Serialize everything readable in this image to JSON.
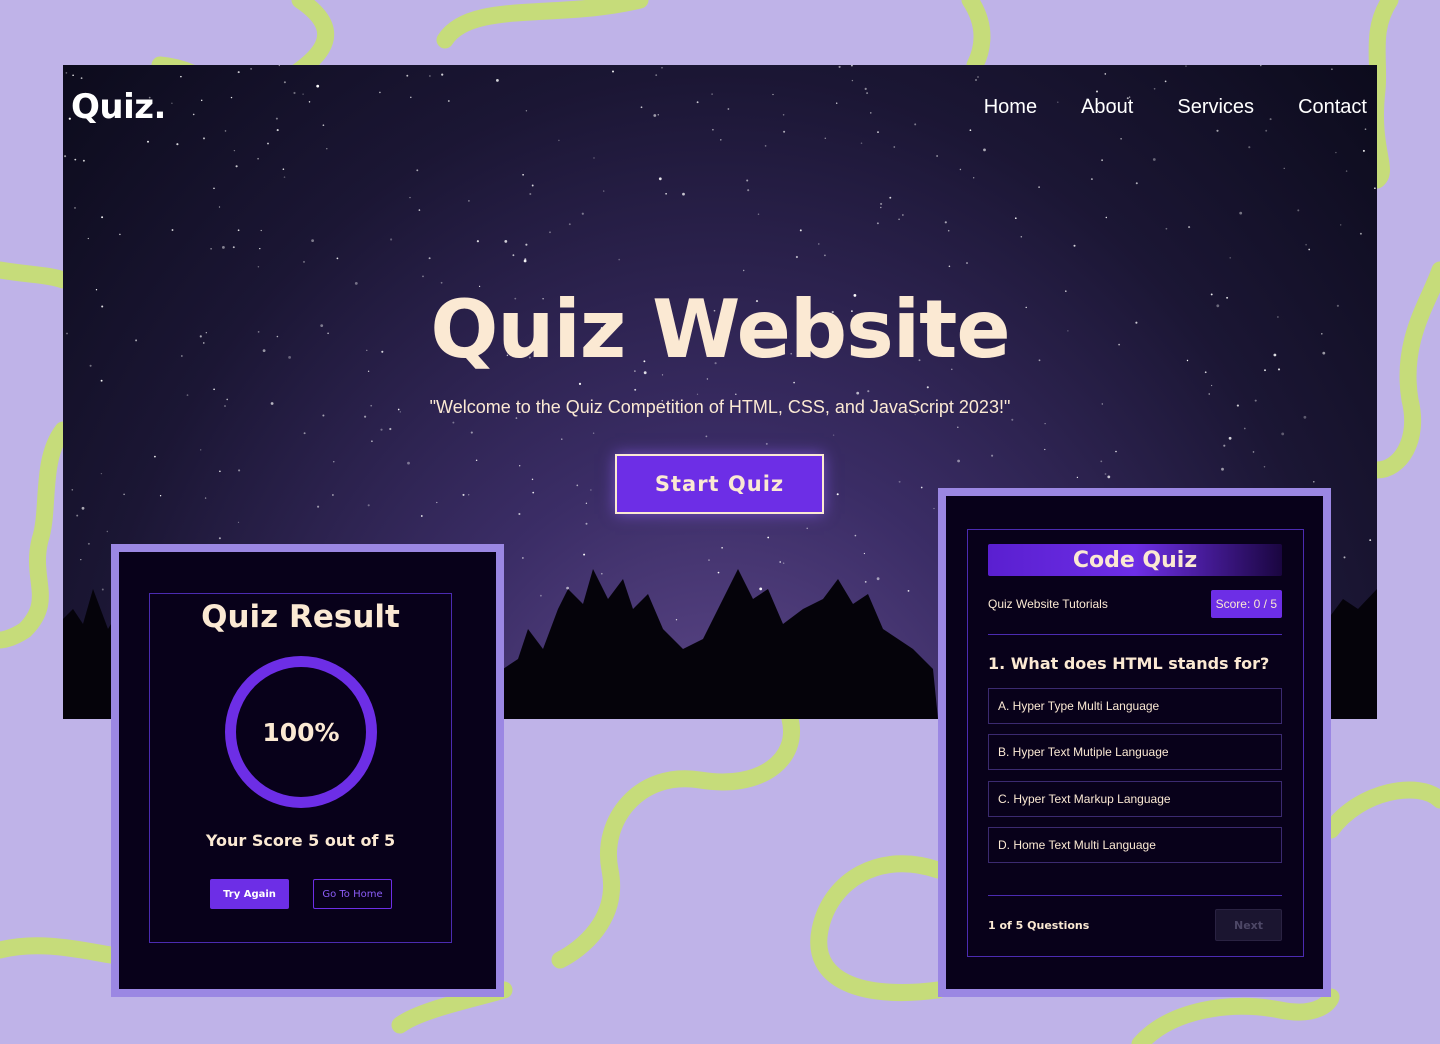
{
  "hero": {
    "logo": "Quiz.",
    "nav": [
      "Home",
      "About",
      "Services",
      "Contact"
    ],
    "title": "Quiz Website",
    "subtitle": "\"Welcome to the Quiz Competition of HTML, CSS, and JavaScript 2023!\"",
    "cta": "Start Quiz"
  },
  "result": {
    "title": "Quiz Result",
    "percent": "100%",
    "score_text": "Your Score 5 out of 5",
    "try_again": "Try Again",
    "go_home": "Go To Home"
  },
  "quiz": {
    "header": "Code Quiz",
    "tutorial": "Quiz Website Tutorials",
    "score": "Score: 0 / 5",
    "question": "1. What does HTML stands for?",
    "options": [
      "A. Hyper Type Multi Language",
      "B. Hyper Text Mutiple Language",
      "C. Hyper Text Markup Language",
      "D. Home Text Multi Language"
    ],
    "progress": "1 of 5 Questions",
    "next": "Next"
  },
  "colors": {
    "background": "#bfb3e8",
    "squiggle": "#c6dc7a",
    "accent": "#6d2ee6",
    "text": "#fbe9d3",
    "card_bg": "#08011a",
    "frame": "#9b87e3"
  }
}
